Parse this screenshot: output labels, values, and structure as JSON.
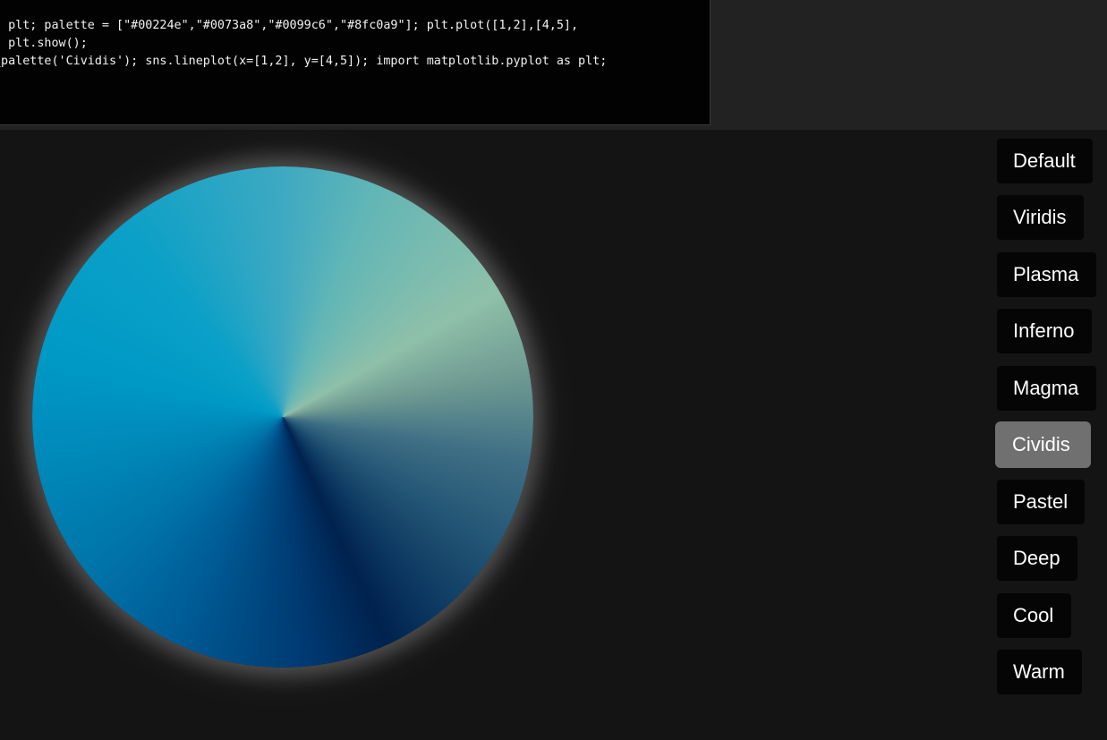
{
  "code": {
    "lines": [
      "s plt; palette = [\"#00224e\",\"#0073a8\",\"#0099c6\",\"#8fc0a9\"]; plt.plot([1,2],[4,5],",
      ", plt.show();",
      "_palette('Cividis'); sns.lineplot(x=[1,2], y=[4,5]); import matplotlib.pyplot as plt;"
    ]
  },
  "wheel": {
    "palette_colors": [
      "#00224e",
      "#0073a8",
      "#0099c6",
      "#8fc0a9"
    ]
  },
  "palettes": {
    "selected": "Cividis",
    "items": [
      {
        "label": "Default"
      },
      {
        "label": "Viridis"
      },
      {
        "label": "Plasma"
      },
      {
        "label": "Inferno"
      },
      {
        "label": "Magma"
      },
      {
        "label": "Cividis"
      },
      {
        "label": "Pastel"
      },
      {
        "label": "Deep"
      },
      {
        "label": "Cool"
      },
      {
        "label": "Warm"
      }
    ]
  },
  "colors": {
    "background": "#141414",
    "top_band": "#222222",
    "code_background": "#020202",
    "button_background": "#050505",
    "button_active": "#707070"
  }
}
